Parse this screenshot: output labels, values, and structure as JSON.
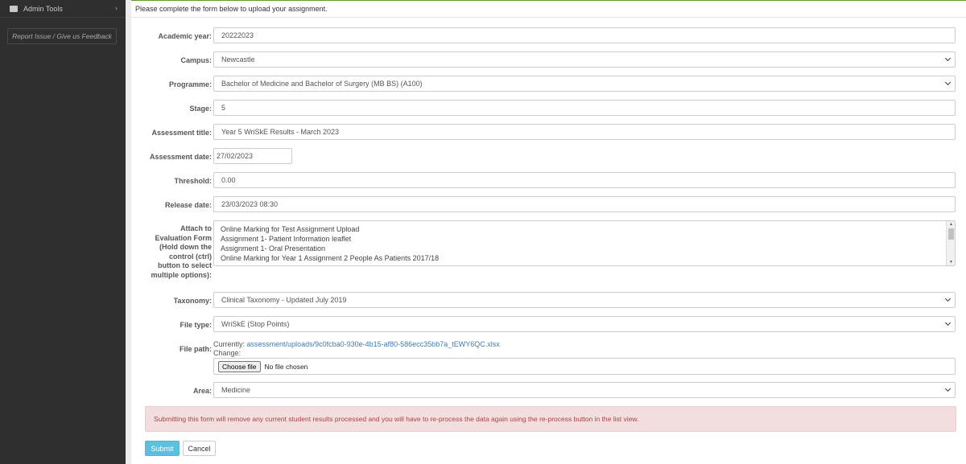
{
  "sidebar": {
    "admin_tools": "Admin Tools",
    "admin_icon": "briefcase-icon",
    "chevron_icon": "chevron-right-icon",
    "feedback": "Report Issue / Give us Feedback"
  },
  "form": {
    "intro": "Please complete the form below to upload your assignment.",
    "academic_year": {
      "label": "Academic year:",
      "value": "20222023"
    },
    "campus": {
      "label": "Campus:",
      "value": "Newcastle"
    },
    "programme": {
      "label": "Programme:",
      "value": "Bachelor of Medicine and Bachelor of Surgery (MB BS) (A100)"
    },
    "stage": {
      "label": "Stage:",
      "value": "5"
    },
    "assessment_title": {
      "label": "Assessment title:",
      "value": "Year 5 WriSkE Results - March 2023"
    },
    "assessment_date": {
      "label": "Assessment date:",
      "value": "27/02/2023"
    },
    "threshold": {
      "label": "Threshold:",
      "value": "0.00"
    },
    "release_date": {
      "label": "Release date:",
      "value": "23/03/2023 08:30"
    },
    "evaluation_form": {
      "label_lines": [
        "Attach to",
        "Evaluation Form",
        "(Hold down the",
        "control (ctrl)",
        "button to select",
        "multiple options):"
      ],
      "options": [
        "Online Marking for Test Assignment Upload",
        "Assignment 1- Patient Information leaflet",
        "Assignment 1- Oral Presentation",
        "Online Marking for Year 1 Assignment 2 People As Patients 2017/18"
      ]
    },
    "taxonomy": {
      "label": "Taxonomy:",
      "value": "Clinical Taxonomy - Updated July 2019"
    },
    "file_type": {
      "label": "File type:",
      "value": "WriSkE (Stop Points)"
    },
    "file_path": {
      "label": "File path:",
      "currently_label": "Currently:",
      "current_link": "assessment/uploads/9c0fcba0-930e-4b15-af80-586ecc35bb7a_tEWY6QC.xlsx",
      "change_label": "Change:",
      "choose_button": "Choose file",
      "no_file": "No file chosen"
    },
    "area": {
      "label": "Area:",
      "value": "Medicine"
    },
    "warning": "Submitting this form will remove any current student results processed and you will have to re-process the data again using the re-process button in the list view.",
    "submit": "Submit",
    "cancel": "Cancel"
  },
  "colors": {
    "sidebar_bg": "#2f2f2f",
    "accent_top": "#5aa02c",
    "submit_bg": "#5bc0de",
    "alert_bg": "#f2dede",
    "alert_text": "#a94442",
    "link": "#3f7cae"
  }
}
